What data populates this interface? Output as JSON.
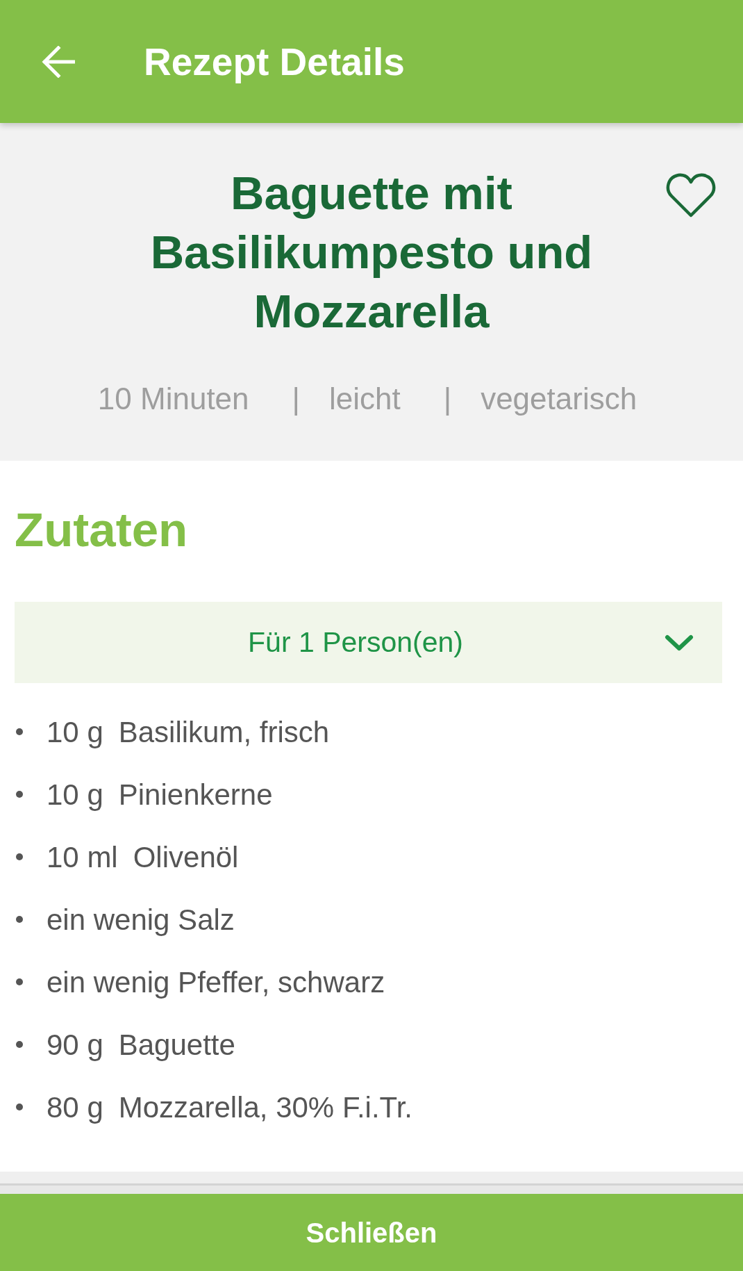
{
  "app_bar": {
    "title": "Rezept Details"
  },
  "recipe": {
    "title": "Baguette mit Basilikumpesto und Mozzarella",
    "favorite": false,
    "meta": [
      {
        "kind": "info",
        "text": "10 Minuten"
      },
      {
        "kind": "separator",
        "text": "|"
      },
      {
        "kind": "info",
        "text": "leicht"
      },
      {
        "kind": "separator",
        "text": "|"
      },
      {
        "kind": "info",
        "text": "vegetarisch"
      }
    ]
  },
  "ingredients": {
    "heading": "Zutaten",
    "servings": {
      "label": "Für 1 Person(en)",
      "expanded": false
    },
    "items": [
      {
        "amount": "10 g",
        "name": "Basilikum, frisch"
      },
      {
        "amount": "10 g",
        "name": "Pinienkerne"
      },
      {
        "amount": "10 ml",
        "name": "Olivenöl"
      },
      {
        "name": "ein wenig Salz"
      },
      {
        "name": "ein wenig Pfeffer, schwarz"
      },
      {
        "amount": "90 g",
        "name": "Baguette"
      },
      {
        "amount": "80 g",
        "name": "Mozzarella, 30% F.i.Tr."
      }
    ]
  },
  "close_button": {
    "label": "Schließen"
  }
}
